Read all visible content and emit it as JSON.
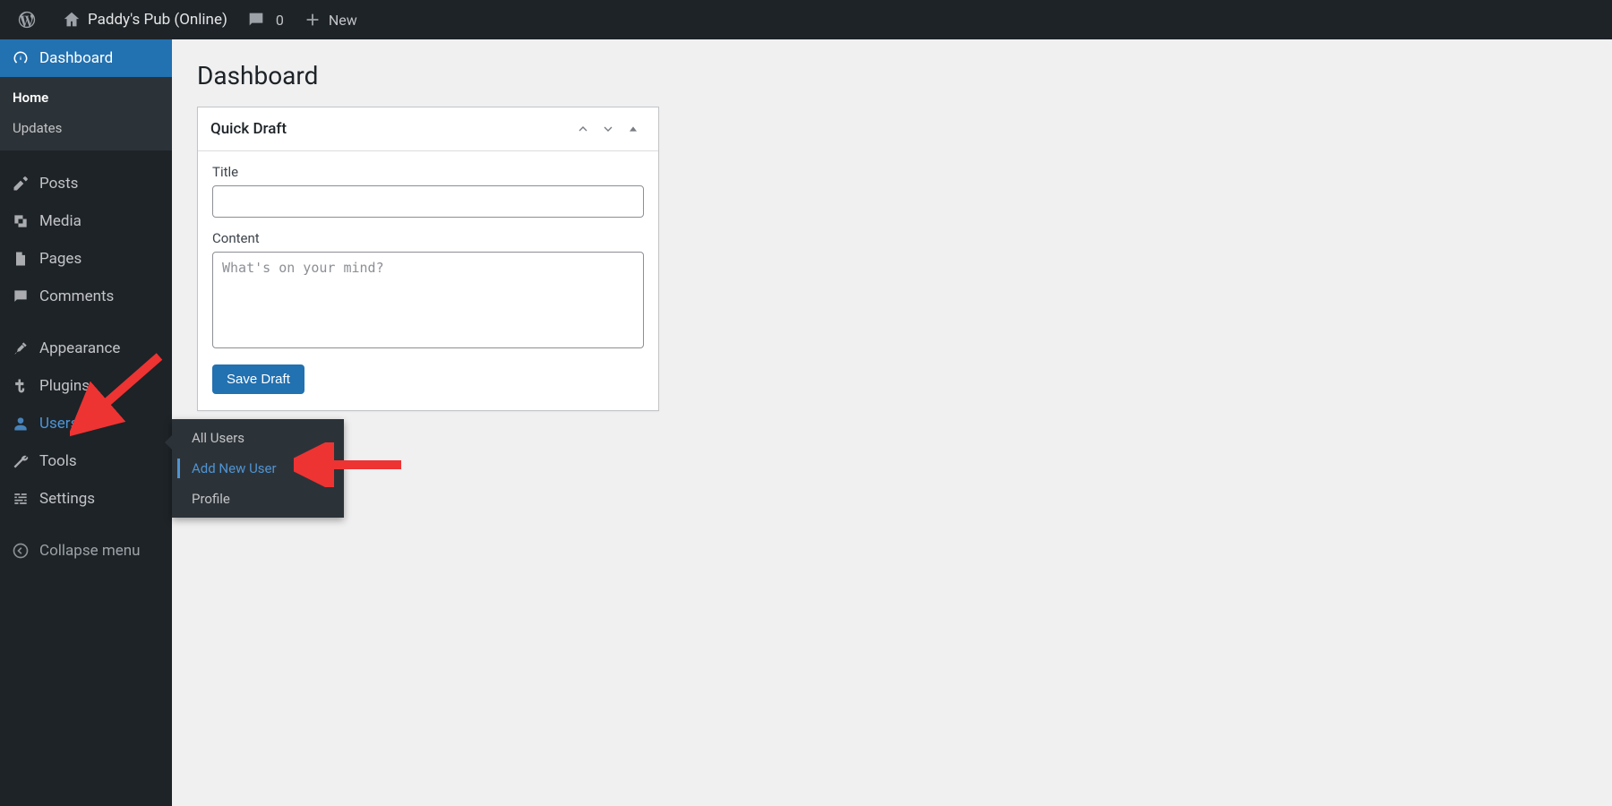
{
  "adminbar": {
    "site_name": "Paddy's Pub (Online)",
    "comments_count": "0",
    "new_label": "New"
  },
  "sidebar": {
    "dashboard": "Dashboard",
    "home": "Home",
    "updates": "Updates",
    "posts": "Posts",
    "media": "Media",
    "pages": "Pages",
    "comments": "Comments",
    "appearance": "Appearance",
    "plugins": "Plugins",
    "users": "Users",
    "tools": "Tools",
    "settings": "Settings",
    "collapse": "Collapse menu"
  },
  "users_submenu": {
    "all_users": "All Users",
    "add_new_user": "Add New User",
    "profile": "Profile"
  },
  "page": {
    "title": "Dashboard"
  },
  "quick_draft": {
    "panel_title": "Quick Draft",
    "title_label": "Title",
    "content_label": "Content",
    "content_placeholder": "What's on your mind?",
    "save_label": "Save Draft"
  }
}
